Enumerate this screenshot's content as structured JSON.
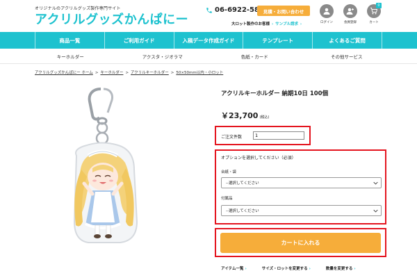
{
  "header": {
    "tagline": "オリジナルのアクリルグッズ製作専門サイト",
    "logo": "アクリルグッズかんぱにー",
    "phone": "06-6922-5872",
    "contact_button": "見積・お問い合わせ",
    "sub_link_1": "大ロット製作のお客様",
    "sub_link_2": "サンプル請求",
    "icons": [
      {
        "label": "ログイン",
        "icon": "user-icon"
      },
      {
        "label": "会員登録",
        "icon": "user-add-icon"
      },
      {
        "label": "カート",
        "icon": "cart-icon",
        "badge": "0"
      }
    ]
  },
  "main_nav": [
    "商品一覧",
    "ご利用ガイド",
    "入稿データ作成ガイド",
    "テンプレート",
    "よくあるご質問"
  ],
  "sub_nav": [
    "キーホルダー",
    "アクスタ・ジオラマ",
    "色紙・カード",
    "その他サービス"
  ],
  "breadcrumb": [
    "アクリルグッズかんぱにー ホーム",
    "キーホルダー",
    "アクリルキーホルダー",
    "50×50mm以内・小ロット"
  ],
  "product": {
    "title": "アクリルキーホルダー 納期10日 100個",
    "price": "￥23,700",
    "tax_note": "(税込)",
    "quantity_label": "ご注文件数",
    "quantity_value": "1",
    "options_title": "オプションを選択してください（必須）",
    "option_1_label": "台紙・袋",
    "option_1_value": "--選択してください",
    "option_2_label": "付属品",
    "option_2_value": "--選択してください",
    "cart_button": "カートに入れる"
  },
  "bottom_links": [
    "アイテム一覧",
    "サイズ・ロットを変更する",
    "数量を変更する"
  ],
  "colors": {
    "accent": "#1ec2cf",
    "orange": "#f6ad3a",
    "highlight": "#e4141e"
  }
}
